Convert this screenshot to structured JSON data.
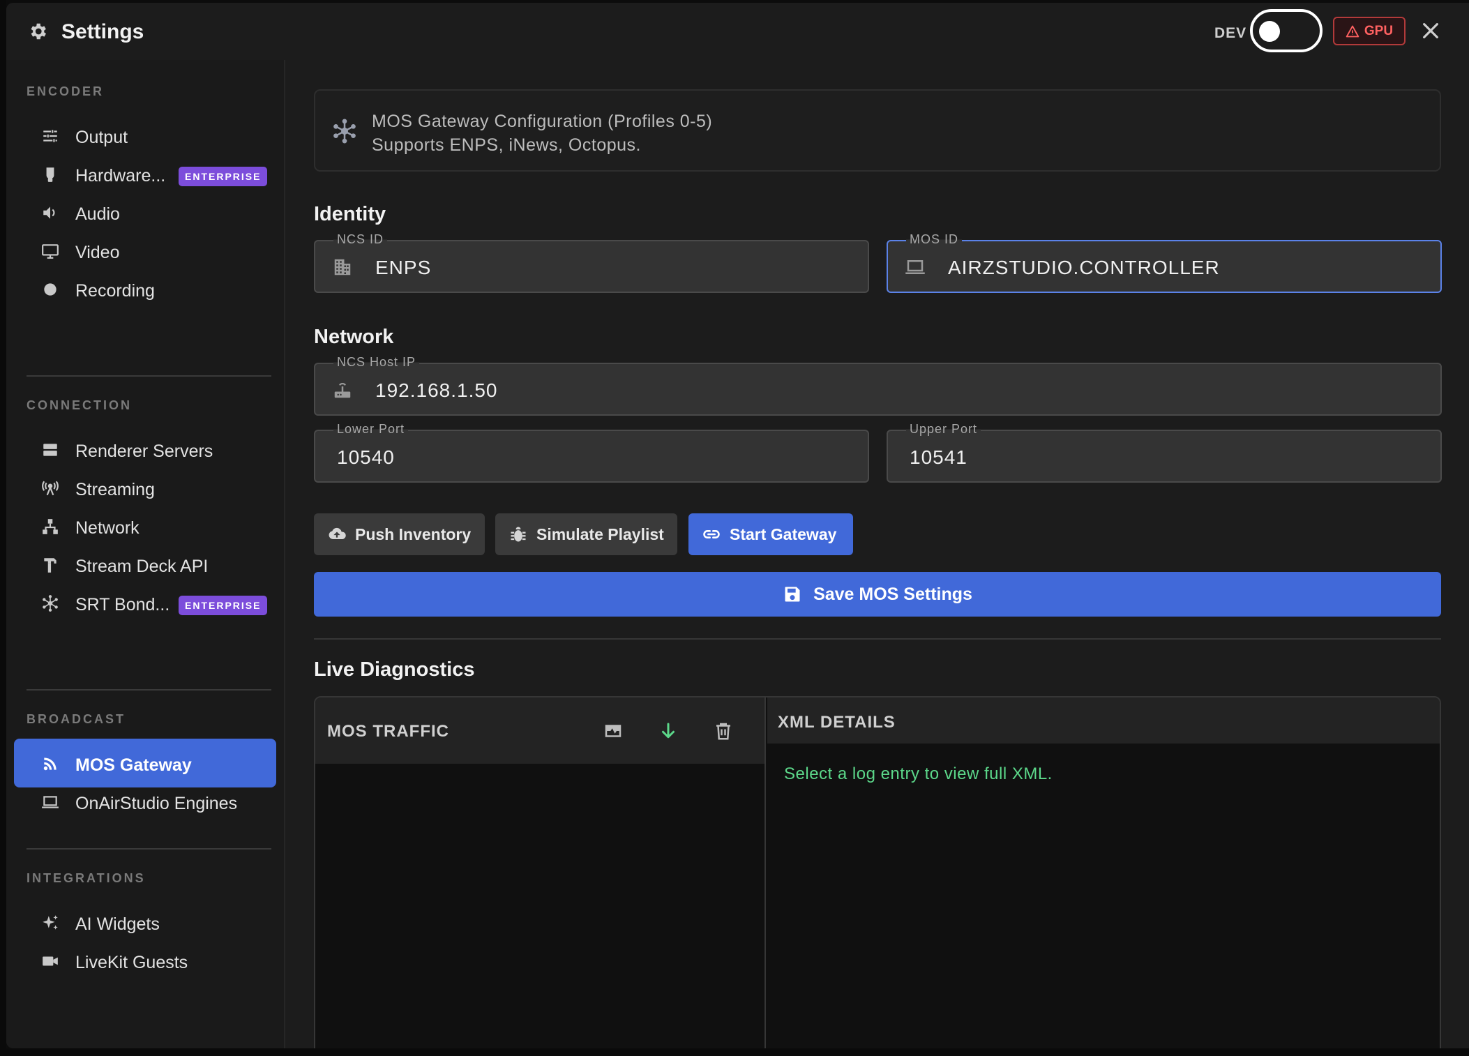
{
  "header": {
    "title": "Settings",
    "dev_label": "DEV",
    "gpu_label": "GPU",
    "dev_toggle_on": false
  },
  "sidebar": {
    "sections": [
      {
        "label": "ENCODER",
        "items": [
          {
            "label": "Output",
            "icon": "sliders-icon"
          },
          {
            "label": "Hardware...",
            "icon": "gpu-card-icon",
            "badge": "ENTERPRISE"
          },
          {
            "label": "Audio",
            "icon": "speaker-icon"
          },
          {
            "label": "Video",
            "icon": "monitor-icon"
          },
          {
            "label": "Recording",
            "icon": "record-dot-icon"
          }
        ]
      },
      {
        "label": "CONNECTION",
        "items": [
          {
            "label": "Renderer Servers",
            "icon": "server-icon"
          },
          {
            "label": "Streaming",
            "icon": "broadcast-tower-icon"
          },
          {
            "label": "Network",
            "icon": "network-tree-icon"
          },
          {
            "label": "Stream Deck API",
            "icon": "hammer-icon"
          },
          {
            "label": "SRT Bond...",
            "icon": "hub-icon",
            "badge": "ENTERPRISE"
          }
        ]
      },
      {
        "label": "BROADCAST",
        "items": [
          {
            "label": "MOS Gateway",
            "icon": "rss-icon",
            "active": true
          },
          {
            "label": "OnAirStudio Engines",
            "icon": "laptop-icon"
          }
        ]
      },
      {
        "label": "INTEGRATIONS",
        "items": [
          {
            "label": "AI Widgets",
            "icon": "sparkle-icon"
          },
          {
            "label": "LiveKit Guests",
            "icon": "video-camera-icon"
          }
        ]
      }
    ]
  },
  "main": {
    "info": {
      "line1": "MOS Gateway Configuration (Profiles 0-5)",
      "line2": "Supports ENPS, iNews, Octopus."
    },
    "identity": {
      "heading": "Identity",
      "ncs_id": {
        "label": "NCS ID",
        "value": "ENPS"
      },
      "mos_id": {
        "label": "MOS ID",
        "value": "AIRZSTUDIO.CONTROLLER"
      }
    },
    "network": {
      "heading": "Network",
      "host": {
        "label": "NCS Host IP",
        "value": "192.168.1.50"
      },
      "lower_port": {
        "label": "Lower Port",
        "value": "10540"
      },
      "upper_port": {
        "label": "Upper Port",
        "value": "10541"
      }
    },
    "actions": {
      "push": "Push Inventory",
      "simulate": "Simulate Playlist",
      "start": "Start Gateway",
      "save": "Save MOS Settings"
    },
    "diagnostics": {
      "heading": "Live Diagnostics",
      "traffic_title": "MOS TRAFFIC",
      "xml_title": "XML DETAILS",
      "xml_message": "Select a log entry to view full XML."
    }
  },
  "colors": {
    "accent": "#4169d9",
    "enterprise_badge": "#7c4ddb",
    "gpu_warning": "#ff6161",
    "success_text": "#5cd88a"
  }
}
